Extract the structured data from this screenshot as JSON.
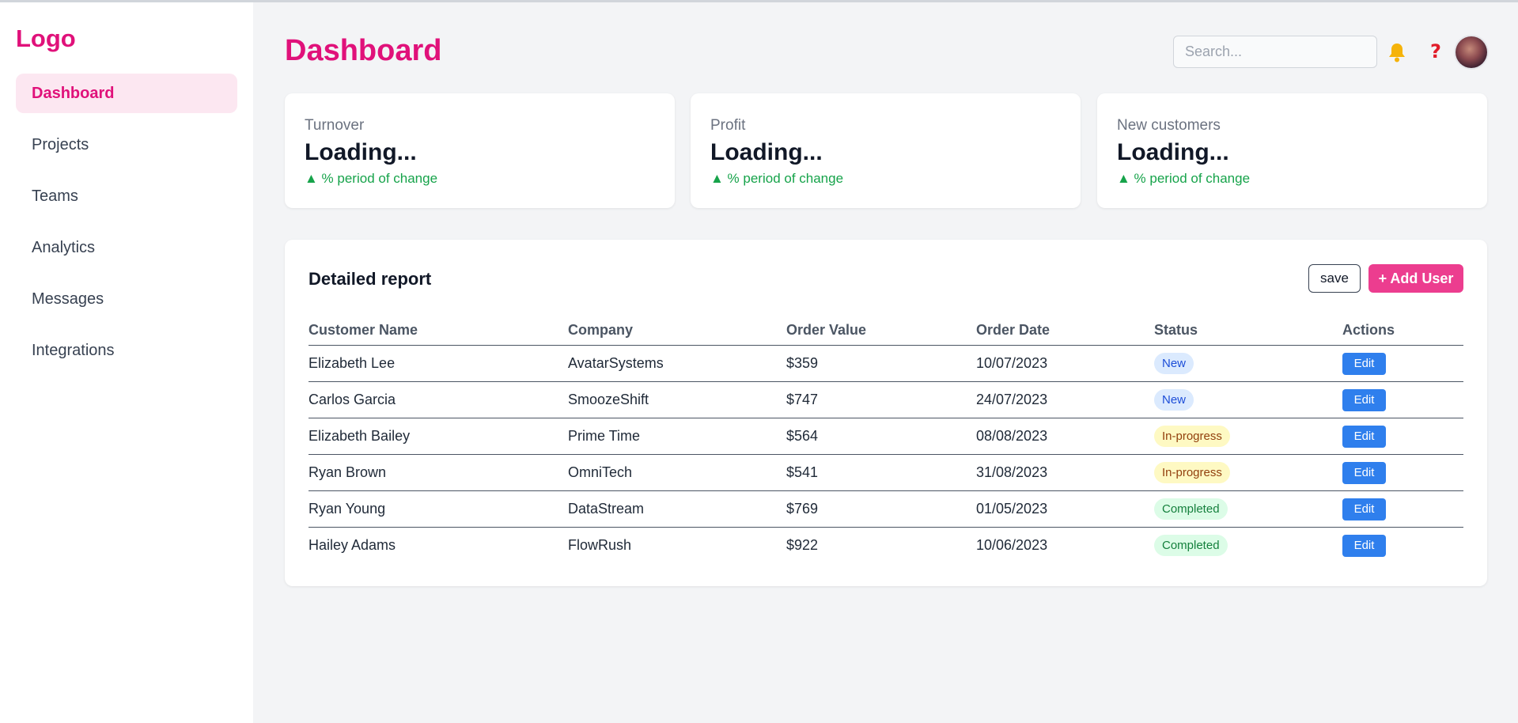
{
  "sidebar": {
    "logo": "Logo",
    "items": [
      {
        "label": "Dashboard",
        "active": true
      },
      {
        "label": "Projects"
      },
      {
        "label": "Teams"
      },
      {
        "label": "Analytics"
      },
      {
        "label": "Messages"
      },
      {
        "label": "Integrations"
      }
    ]
  },
  "header": {
    "title": "Dashboard",
    "search_placeholder": "Search...",
    "bell_icon": "bell-icon",
    "help_icon": "?"
  },
  "stats": [
    {
      "label": "Turnover",
      "value": "Loading...",
      "change": "▲ % period of change"
    },
    {
      "label": "Profit",
      "value": "Loading...",
      "change": "▲ % period of change"
    },
    {
      "label": "New customers",
      "value": "Loading...",
      "change": "▲ % period of change"
    }
  ],
  "report": {
    "title": "Detailed report",
    "save_label": "save",
    "add_user_label": "+ Add User",
    "columns": [
      "Customer Name",
      "Company",
      "Order Value",
      "Order Date",
      "Status",
      "Actions"
    ],
    "rows": [
      {
        "name": "Elizabeth Lee",
        "company": "AvatarSystems",
        "value": "$359",
        "date": "10/07/2023",
        "status": "New",
        "action": "Edit"
      },
      {
        "name": "Carlos Garcia",
        "company": "SmoozeShift",
        "value": "$747",
        "date": "24/07/2023",
        "status": "New",
        "action": "Edit"
      },
      {
        "name": "Elizabeth Bailey",
        "company": "Prime Time",
        "value": "$564",
        "date": "08/08/2023",
        "status": "In-progress",
        "action": "Edit"
      },
      {
        "name": "Ryan Brown",
        "company": "OmniTech",
        "value": "$541",
        "date": "31/08/2023",
        "status": "In-progress",
        "action": "Edit"
      },
      {
        "name": "Ryan Young",
        "company": "DataStream",
        "value": "$769",
        "date": "01/05/2023",
        "status": "Completed",
        "action": "Edit"
      },
      {
        "name": "Hailey Adams",
        "company": "FlowRush",
        "value": "$922",
        "date": "10/06/2023",
        "status": "Completed",
        "action": "Edit"
      }
    ]
  },
  "colors": {
    "brand": "#e0117a",
    "add_button": "#ec3d8f",
    "edit_button": "#2f7fed",
    "positive": "#16a34a"
  }
}
